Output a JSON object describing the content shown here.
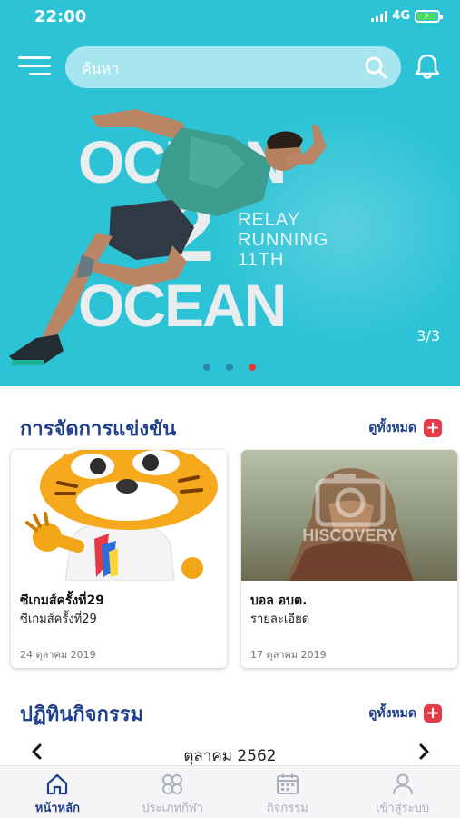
{
  "status_bar": {
    "time": "22:00",
    "network": "4G"
  },
  "search": {
    "placeholder": "ค้นหา"
  },
  "banner": {
    "headline_top": "OCEAN",
    "headline_mid": "2",
    "headline_bottom": "OCEAN",
    "tagline": [
      "RELAY",
      "RUNNING",
      "11TH"
    ],
    "counter": "3/3",
    "slide_count": 3,
    "active_slide": 3
  },
  "competitions": {
    "title": "การจัดการแข่งขัน",
    "see_all": "ดูทั้งหมด",
    "cards": [
      {
        "title": "ซีเกมส์ครั้งที่29",
        "subtitle": "ซีเกมส์ครั้งที่29",
        "date": "24 ตุลาคม 2019"
      },
      {
        "title": "บอล อบต.",
        "subtitle": "รายละเอียด",
        "date": "17 ตุลาคม 2019",
        "watermark": "HISCOVERY"
      }
    ]
  },
  "calendar": {
    "title": "ปฏิทินกิจกรรม",
    "see_all": "ดูทั้งหมด",
    "month": "ตุลาคม 2562"
  },
  "bottom_nav": {
    "items": [
      {
        "label": "หน้าหลัก",
        "icon": "home-icon",
        "active": true
      },
      {
        "label": "ประเภทกีฬา",
        "icon": "sports-icon",
        "active": false
      },
      {
        "label": "กิจกรรม",
        "icon": "calendar-icon",
        "active": false
      },
      {
        "label": "เข้าสู่ระบบ",
        "icon": "user-icon",
        "active": false
      }
    ]
  },
  "colors": {
    "hero_bg": "#2cc3d6",
    "primary_text": "#1f3f8a",
    "accent_red": "#e53945",
    "nav_inactive": "#a9b0bc"
  }
}
